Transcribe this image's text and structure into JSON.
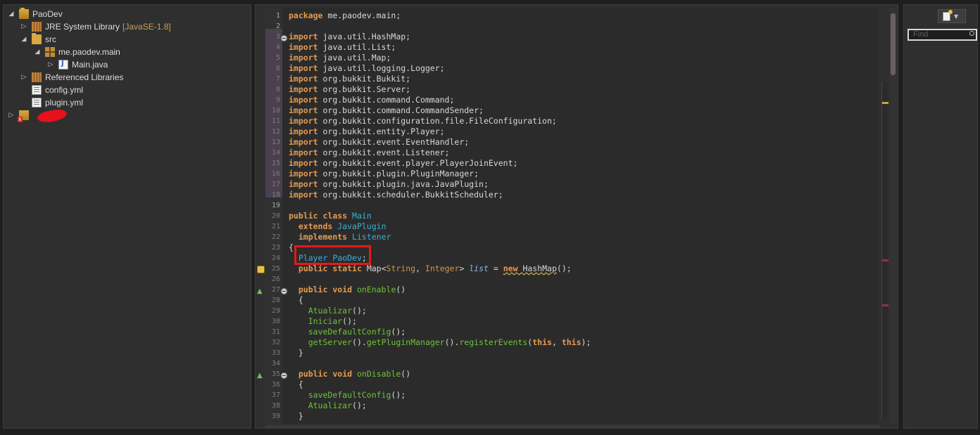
{
  "explorer": {
    "project_name": "PaoDev",
    "jre_label": "JRE System Library",
    "jre_version": "[JavaSE-1.8]",
    "src_label": "src",
    "package_name": "me.paodev.main",
    "main_file": "Main.java",
    "ref_libs": "Referenced Libraries",
    "config_file": "config.yml",
    "plugin_file": "plugin.yml"
  },
  "editor": {
    "line_numbers": [
      "1",
      "2",
      "3",
      "4",
      "5",
      "6",
      "7",
      "8",
      "9",
      "10",
      "11",
      "12",
      "13",
      "14",
      "15",
      "16",
      "17",
      "18",
      "19",
      "20",
      "21",
      "22",
      "23",
      "24",
      "25",
      "26",
      "27",
      "28",
      "29",
      "30",
      "31",
      "32",
      "33",
      "34",
      "35",
      "36",
      "37",
      "38",
      "39"
    ],
    "lines": [
      [
        {
          "t": "package",
          "c": "kw"
        },
        {
          "t": " me.paodev.main;",
          "c": ""
        }
      ],
      [],
      [
        {
          "t": "import",
          "c": "kw"
        },
        {
          "t": " java.util.HashMap;",
          "c": ""
        }
      ],
      [
        {
          "t": "import",
          "c": "kw"
        },
        {
          "t": " java.util.List;",
          "c": ""
        }
      ],
      [
        {
          "t": "import",
          "c": "kw"
        },
        {
          "t": " java.util.Map;",
          "c": ""
        }
      ],
      [
        {
          "t": "import",
          "c": "kw"
        },
        {
          "t": " java.util.logging.Logger;",
          "c": ""
        }
      ],
      [
        {
          "t": "import",
          "c": "kw"
        },
        {
          "t": " org.bukkit.Bukkit;",
          "c": ""
        }
      ],
      [
        {
          "t": "import",
          "c": "kw"
        },
        {
          "t": " org.bukkit.Server;",
          "c": ""
        }
      ],
      [
        {
          "t": "import",
          "c": "kw"
        },
        {
          "t": " org.bukkit.command.Command;",
          "c": ""
        }
      ],
      [
        {
          "t": "import",
          "c": "kw"
        },
        {
          "t": " org.bukkit.command.CommandSender;",
          "c": ""
        }
      ],
      [
        {
          "t": "import",
          "c": "kw"
        },
        {
          "t": " org.bukkit.configuration.file.FileConfiguration;",
          "c": ""
        }
      ],
      [
        {
          "t": "import",
          "c": "kw"
        },
        {
          "t": " org.bukkit.entity.Player;",
          "c": ""
        }
      ],
      [
        {
          "t": "import",
          "c": "kw"
        },
        {
          "t": " org.bukkit.event.EventHandler;",
          "c": ""
        }
      ],
      [
        {
          "t": "import",
          "c": "kw"
        },
        {
          "t": " org.bukkit.event.Listener;",
          "c": ""
        }
      ],
      [
        {
          "t": "import",
          "c": "kw"
        },
        {
          "t": " org.bukkit.event.player.PlayerJoinEvent;",
          "c": ""
        }
      ],
      [
        {
          "t": "import",
          "c": "kw"
        },
        {
          "t": " org.bukkit.plugin.PluginManager;",
          "c": ""
        }
      ],
      [
        {
          "t": "import",
          "c": "kw"
        },
        {
          "t": " org.bukkit.plugin.java.JavaPlugin;",
          "c": ""
        }
      ],
      [
        {
          "t": "import",
          "c": "kw"
        },
        {
          "t": " org.bukkit.scheduler.BukkitScheduler;",
          "c": ""
        }
      ],
      [],
      [
        {
          "t": "public",
          "c": "kw"
        },
        {
          "t": " ",
          "c": ""
        },
        {
          "t": "class",
          "c": "kw"
        },
        {
          "t": " ",
          "c": ""
        },
        {
          "t": "Main",
          "c": "type"
        }
      ],
      [
        {
          "t": "  ",
          "c": ""
        },
        {
          "t": "extends",
          "c": "kw"
        },
        {
          "t": " ",
          "c": ""
        },
        {
          "t": "JavaPlugin",
          "c": "type"
        }
      ],
      [
        {
          "t": "  ",
          "c": ""
        },
        {
          "t": "implements",
          "c": "kw"
        },
        {
          "t": " ",
          "c": ""
        },
        {
          "t": "Listener",
          "c": "type"
        }
      ],
      [
        {
          "t": "{",
          "c": ""
        }
      ],
      [
        {
          "t": "  ",
          "c": ""
        },
        {
          "t": "Player",
          "c": "type"
        },
        {
          "t": " ",
          "c": ""
        },
        {
          "t": "PaoDev",
          "c": "type"
        },
        {
          "t": ";",
          "c": ""
        }
      ],
      [
        {
          "t": "  ",
          "c": ""
        },
        {
          "t": "public",
          "c": "kw"
        },
        {
          "t": " ",
          "c": ""
        },
        {
          "t": "static",
          "c": "kw"
        },
        {
          "t": " Map<",
          "c": ""
        },
        {
          "t": "String",
          "c": "ty2"
        },
        {
          "t": ", ",
          "c": ""
        },
        {
          "t": "Integer",
          "c": "ty2"
        },
        {
          "t": "> ",
          "c": ""
        },
        {
          "t": "list",
          "c": "ital"
        },
        {
          "t": " = ",
          "c": ""
        },
        {
          "t": "new",
          "c": "kw warn-u"
        },
        {
          "t": " HashMap",
          "c": "warn-u"
        },
        {
          "t": "();",
          "c": ""
        }
      ],
      [],
      [
        {
          "t": "  ",
          "c": ""
        },
        {
          "t": "public",
          "c": "kw"
        },
        {
          "t": " ",
          "c": ""
        },
        {
          "t": "void",
          "c": "kw"
        },
        {
          "t": " ",
          "c": ""
        },
        {
          "t": "onEnable",
          "c": "meth"
        },
        {
          "t": "()",
          "c": ""
        }
      ],
      [
        {
          "t": "  {",
          "c": ""
        }
      ],
      [
        {
          "t": "    ",
          "c": ""
        },
        {
          "t": "Atualizar",
          "c": "meth"
        },
        {
          "t": "();",
          "c": ""
        }
      ],
      [
        {
          "t": "    ",
          "c": ""
        },
        {
          "t": "Iniciar",
          "c": "meth"
        },
        {
          "t": "();",
          "c": ""
        }
      ],
      [
        {
          "t": "    ",
          "c": ""
        },
        {
          "t": "saveDefaultConfig",
          "c": "meth"
        },
        {
          "t": "();",
          "c": ""
        }
      ],
      [
        {
          "t": "    ",
          "c": ""
        },
        {
          "t": "getServer",
          "c": "meth"
        },
        {
          "t": "().",
          "c": ""
        },
        {
          "t": "getPluginManager",
          "c": "meth"
        },
        {
          "t": "().",
          "c": ""
        },
        {
          "t": "registerEvents",
          "c": "meth"
        },
        {
          "t": "(",
          "c": ""
        },
        {
          "t": "this",
          "c": "kw"
        },
        {
          "t": ", ",
          "c": ""
        },
        {
          "t": "this",
          "c": "kw"
        },
        {
          "t": ");",
          "c": ""
        }
      ],
      [
        {
          "t": "  }",
          "c": ""
        }
      ],
      [],
      [
        {
          "t": "  ",
          "c": ""
        },
        {
          "t": "public",
          "c": "kw"
        },
        {
          "t": " ",
          "c": ""
        },
        {
          "t": "void",
          "c": "kw"
        },
        {
          "t": " ",
          "c": ""
        },
        {
          "t": "onDisable",
          "c": "meth"
        },
        {
          "t": "()",
          "c": ""
        }
      ],
      [
        {
          "t": "  {",
          "c": ""
        }
      ],
      [
        {
          "t": "    ",
          "c": ""
        },
        {
          "t": "saveDefaultConfig",
          "c": "meth"
        },
        {
          "t": "();",
          "c": ""
        }
      ],
      [
        {
          "t": "    ",
          "c": ""
        },
        {
          "t": "Atualizar",
          "c": "meth"
        },
        {
          "t": "();",
          "c": ""
        }
      ],
      [
        {
          "t": "  }",
          "c": ""
        }
      ]
    ]
  },
  "right_panel": {
    "find_placeholder": "Find"
  },
  "colors": {
    "keyword": "#e69a50",
    "type": "#3ab0d6",
    "method": "#6fc23a",
    "highlight": "#e5191b"
  }
}
